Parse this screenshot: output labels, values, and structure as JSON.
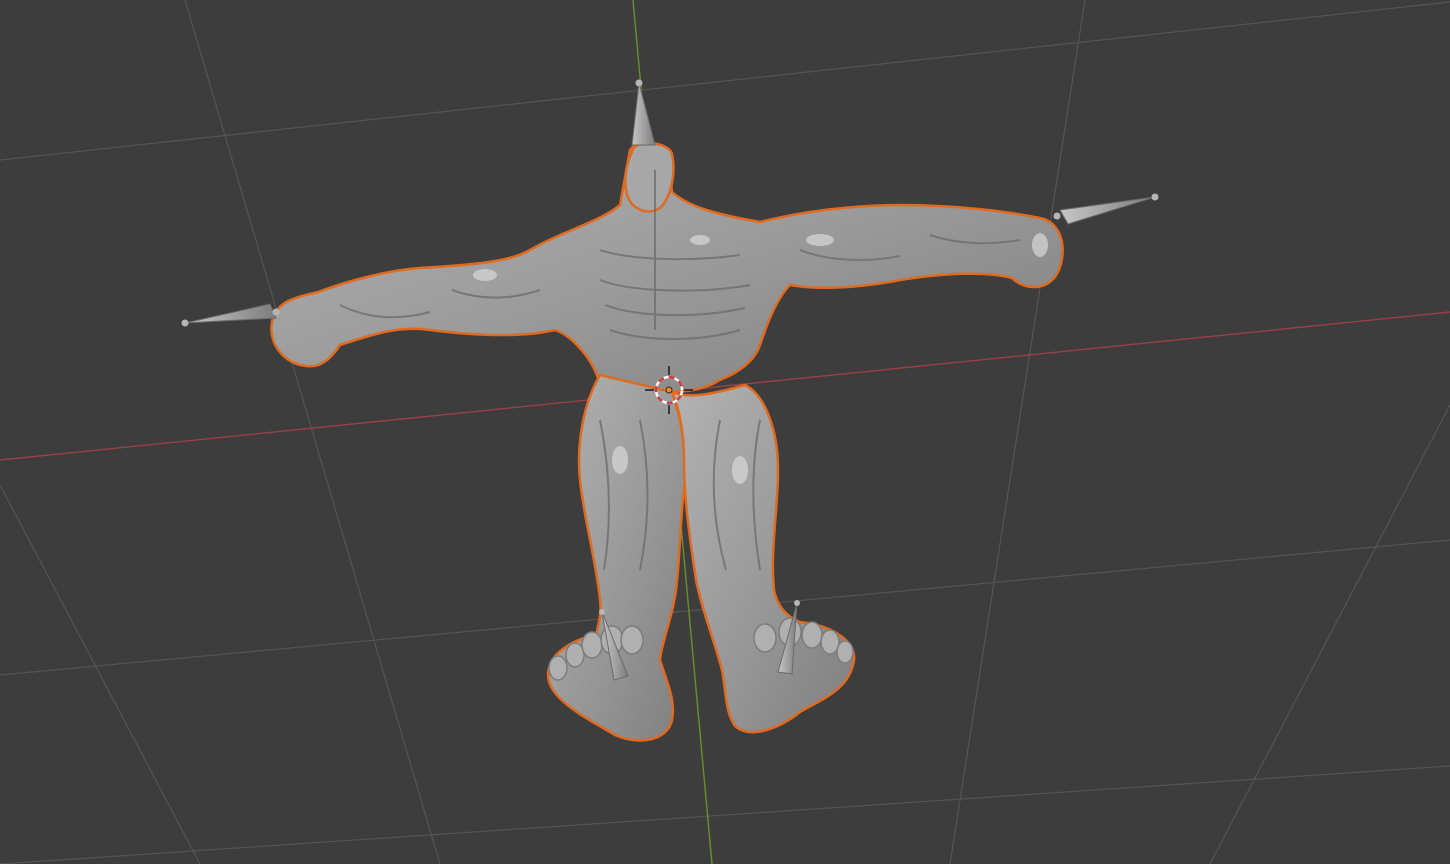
{
  "app": "3D Viewport",
  "viewport": {
    "background_color": "#3d3d3d",
    "grid_color": "#5b5b5b",
    "x_axis_color": "#b04a55",
    "y_axis_color": "#6e9a2d",
    "selection_outline_color": "#e06a20",
    "mesh_color": "#9e9e9e",
    "bone_color": "#a6a6a6"
  },
  "scene": {
    "selected_object": "humanoid-mesh",
    "objects": [
      {
        "name": "humanoid-mesh",
        "type": "mesh",
        "selected": true
      },
      {
        "name": "armature",
        "type": "armature",
        "bones": [
          "head-bone",
          "left-arm-bone",
          "right-arm-bone",
          "left-foot-bone",
          "right-foot-bone"
        ]
      }
    ],
    "cursor": {
      "name": "3d-cursor"
    },
    "origin": {
      "name": "object-origin"
    }
  }
}
